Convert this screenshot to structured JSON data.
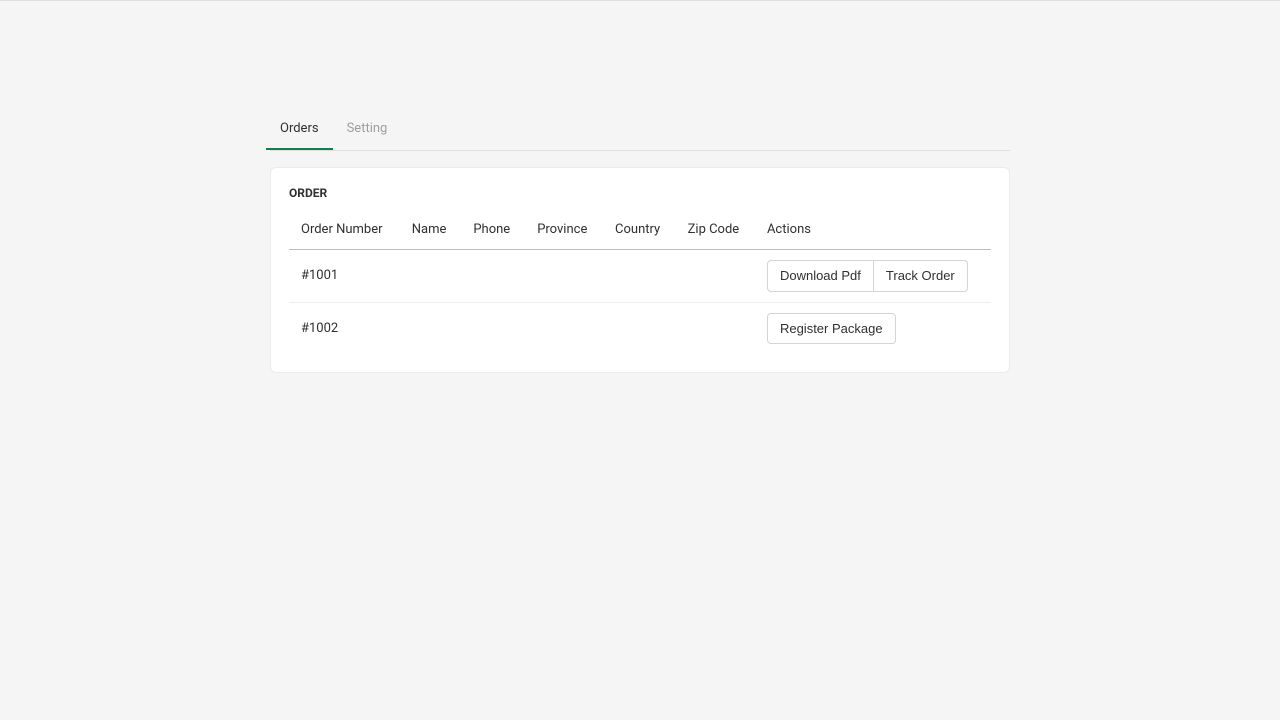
{
  "tabs": {
    "orders": "Orders",
    "setting": "Setting"
  },
  "card": {
    "title": "ORDER"
  },
  "table": {
    "headers": {
      "orderNumber": "Order Number",
      "name": "Name",
      "phone": "Phone",
      "province": "Province",
      "country": "Country",
      "zipCode": "Zip Code",
      "actions": "Actions"
    },
    "rows": [
      {
        "orderNumber": "#1001",
        "name": "",
        "phone": "",
        "province": "",
        "country": "",
        "zipCode": "",
        "actions": {
          "downloadPdf": "Download Pdf",
          "trackOrder": "Track Order"
        }
      },
      {
        "orderNumber": "#1002",
        "name": "",
        "phone": "",
        "province": "",
        "country": "",
        "zipCode": "",
        "actions": {
          "registerPackage": "Register Package"
        }
      }
    ]
  }
}
